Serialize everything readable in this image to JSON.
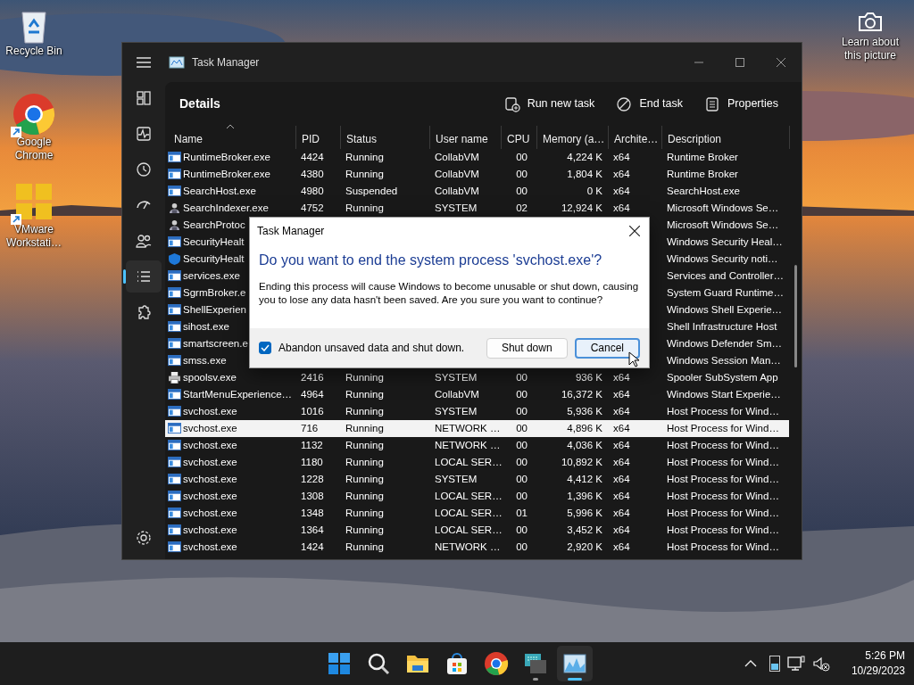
{
  "desktop": {
    "icons": [
      {
        "kind": "recycle",
        "label": "Recycle Bin",
        "shortcut": false
      },
      {
        "kind": "browser",
        "label": "Google Chrome",
        "shortcut": true
      },
      {
        "kind": "vmware",
        "label": "VMware Workstati…",
        "shortcut": true
      }
    ],
    "spotlight": {
      "label": "Learn about this picture"
    }
  },
  "window": {
    "title": "Task Manager",
    "sidebar": [
      {
        "kind": "processes",
        "selected": false
      },
      {
        "kind": "performance",
        "selected": false
      },
      {
        "kind": "history",
        "selected": false
      },
      {
        "kind": "startup",
        "selected": false
      },
      {
        "kind": "users",
        "selected": false
      },
      {
        "kind": "details",
        "selected": true
      },
      {
        "kind": "services",
        "selected": false
      },
      {
        "kind": "settings",
        "selected": false
      }
    ],
    "page_title": "Details",
    "toolbar": [
      {
        "kind": "run",
        "label": "Run new task"
      },
      {
        "kind": "end",
        "label": "End task"
      },
      {
        "kind": "properties",
        "label": "Properties"
      }
    ],
    "table": {
      "columns": [
        "Name",
        "PID",
        "Status",
        "User name",
        "CPU",
        "Memory (a…",
        "Archite…",
        "Description"
      ],
      "rows": [
        {
          "kind": "app",
          "name": "RuntimeBroker.exe",
          "pid": "4424",
          "status": "Running",
          "user": "CollabVM",
          "cpu": "00",
          "memory": "4,224 K",
          "arch": "x64",
          "description": "Runtime Broker",
          "selected": false
        },
        {
          "kind": "app",
          "name": "RuntimeBroker.exe",
          "pid": "4380",
          "status": "Running",
          "user": "CollabVM",
          "cpu": "00",
          "memory": "1,804 K",
          "arch": "x64",
          "description": "Runtime Broker",
          "selected": false
        },
        {
          "kind": "app",
          "name": "SearchHost.exe",
          "pid": "4980",
          "status": "Suspended",
          "user": "CollabVM",
          "cpu": "00",
          "memory": "0 K",
          "arch": "x64",
          "description": "SearchHost.exe",
          "selected": false
        },
        {
          "kind": "user",
          "name": "SearchIndexer.exe",
          "pid": "4752",
          "status": "Running",
          "user": "SYSTEM",
          "cpu": "02",
          "memory": "12,924 K",
          "arch": "x64",
          "description": "Microsoft Windows Se…",
          "selected": false
        },
        {
          "kind": "user",
          "name": "SearchProtoc",
          "description": "Microsoft Windows Se…",
          "selected": false
        },
        {
          "kind": "app",
          "name": "SecurityHealt",
          "description": "Windows Security Heal…",
          "selected": false
        },
        {
          "kind": "shield",
          "name": "SecurityHealt",
          "description": "Windows Security noti…",
          "selected": false
        },
        {
          "kind": "app",
          "name": "services.exe",
          "description": "Services and Controller…",
          "selected": false
        },
        {
          "kind": "app",
          "name": "SgrmBroker.e",
          "description": "System Guard Runtime…",
          "selected": false
        },
        {
          "kind": "app",
          "name": "ShellExperien",
          "description": "Windows Shell Experie…",
          "selected": false
        },
        {
          "kind": "app",
          "name": "sihost.exe",
          "description": "Shell Infrastructure Host",
          "selected": false
        },
        {
          "kind": "app",
          "name": "smartscreen.e",
          "description": "Windows Defender Sm…",
          "selected": false
        },
        {
          "kind": "app",
          "name": "smss.exe",
          "description": "Windows Session Man…",
          "selected": false
        },
        {
          "kind": "printer",
          "name": "spoolsv.exe",
          "pid": "2416",
          "status": "Running",
          "user": "SYSTEM",
          "cpu": "00",
          "memory": "936 K",
          "arch": "x64",
          "description": "Spooler SubSystem App",
          "selected": false
        },
        {
          "kind": "app",
          "name": "StartMenuExperience…",
          "pid": "4964",
          "status": "Running",
          "user": "CollabVM",
          "cpu": "00",
          "memory": "16,372 K",
          "arch": "x64",
          "description": "Windows Start Experie…",
          "selected": false
        },
        {
          "kind": "app",
          "name": "svchost.exe",
          "pid": "1016",
          "status": "Running",
          "user": "SYSTEM",
          "cpu": "00",
          "memory": "5,936 K",
          "arch": "x64",
          "description": "Host Process for Wind…",
          "selected": false
        },
        {
          "kind": "app",
          "name": "svchost.exe",
          "pid": "716",
          "status": "Running",
          "user": "NETWORK …",
          "cpu": "00",
          "memory": "4,896 K",
          "arch": "x64",
          "description": "Host Process for Wind…",
          "selected": true
        },
        {
          "kind": "app",
          "name": "svchost.exe",
          "pid": "1132",
          "status": "Running",
          "user": "NETWORK …",
          "cpu": "00",
          "memory": "4,036 K",
          "arch": "x64",
          "description": "Host Process for Wind…",
          "selected": false
        },
        {
          "kind": "app",
          "name": "svchost.exe",
          "pid": "1180",
          "status": "Running",
          "user": "LOCAL SER…",
          "cpu": "00",
          "memory": "10,892 K",
          "arch": "x64",
          "description": "Host Process for Wind…",
          "selected": false
        },
        {
          "kind": "app",
          "name": "svchost.exe",
          "pid": "1228",
          "status": "Running",
          "user": "SYSTEM",
          "cpu": "00",
          "memory": "4,412 K",
          "arch": "x64",
          "description": "Host Process for Wind…",
          "selected": false
        },
        {
          "kind": "app",
          "name": "svchost.exe",
          "pid": "1308",
          "status": "Running",
          "user": "LOCAL SER…",
          "cpu": "00",
          "memory": "1,396 K",
          "arch": "x64",
          "description": "Host Process for Wind…",
          "selected": false
        },
        {
          "kind": "app",
          "name": "svchost.exe",
          "pid": "1348",
          "status": "Running",
          "user": "LOCAL SER…",
          "cpu": "01",
          "memory": "5,996 K",
          "arch": "x64",
          "description": "Host Process for Wind…",
          "selected": false
        },
        {
          "kind": "app",
          "name": "svchost.exe",
          "pid": "1364",
          "status": "Running",
          "user": "LOCAL SER…",
          "cpu": "00",
          "memory": "3,452 K",
          "arch": "x64",
          "description": "Host Process for Wind…",
          "selected": false
        },
        {
          "kind": "app",
          "name": "svchost.exe",
          "pid": "1424",
          "status": "Running",
          "user": "NETWORK …",
          "cpu": "00",
          "memory": "2,920 K",
          "arch": "x64",
          "description": "Host Process for Wind…",
          "selected": false
        }
      ]
    }
  },
  "dialog": {
    "title": "Task Manager",
    "heading": "Do you want to end the system process 'svchost.exe'?",
    "message": "Ending this process will cause Windows to become unusable or shut down, causing you to lose any data hasn't been saved. Are you sure you want to continue?",
    "checkbox": {
      "label": "Abandon unsaved data and shut down.",
      "checked": true
    },
    "buttons": [
      {
        "label": "Shut down",
        "default": false
      },
      {
        "label": "Cancel",
        "default": true
      }
    ]
  },
  "taskbar": {
    "apps": [
      {
        "kind": "start",
        "selected": false,
        "running": false
      },
      {
        "kind": "search",
        "selected": false,
        "running": false
      },
      {
        "kind": "folder",
        "selected": false,
        "running": false
      },
      {
        "kind": "store",
        "selected": false,
        "running": false
      },
      {
        "kind": "browser",
        "selected": false,
        "running": false
      },
      {
        "kind": "remote",
        "selected": false,
        "running": true
      },
      {
        "kind": "taskmgr",
        "selected": true,
        "running": true
      }
    ],
    "time": "5:26 PM",
    "date": "10/29/2023"
  }
}
